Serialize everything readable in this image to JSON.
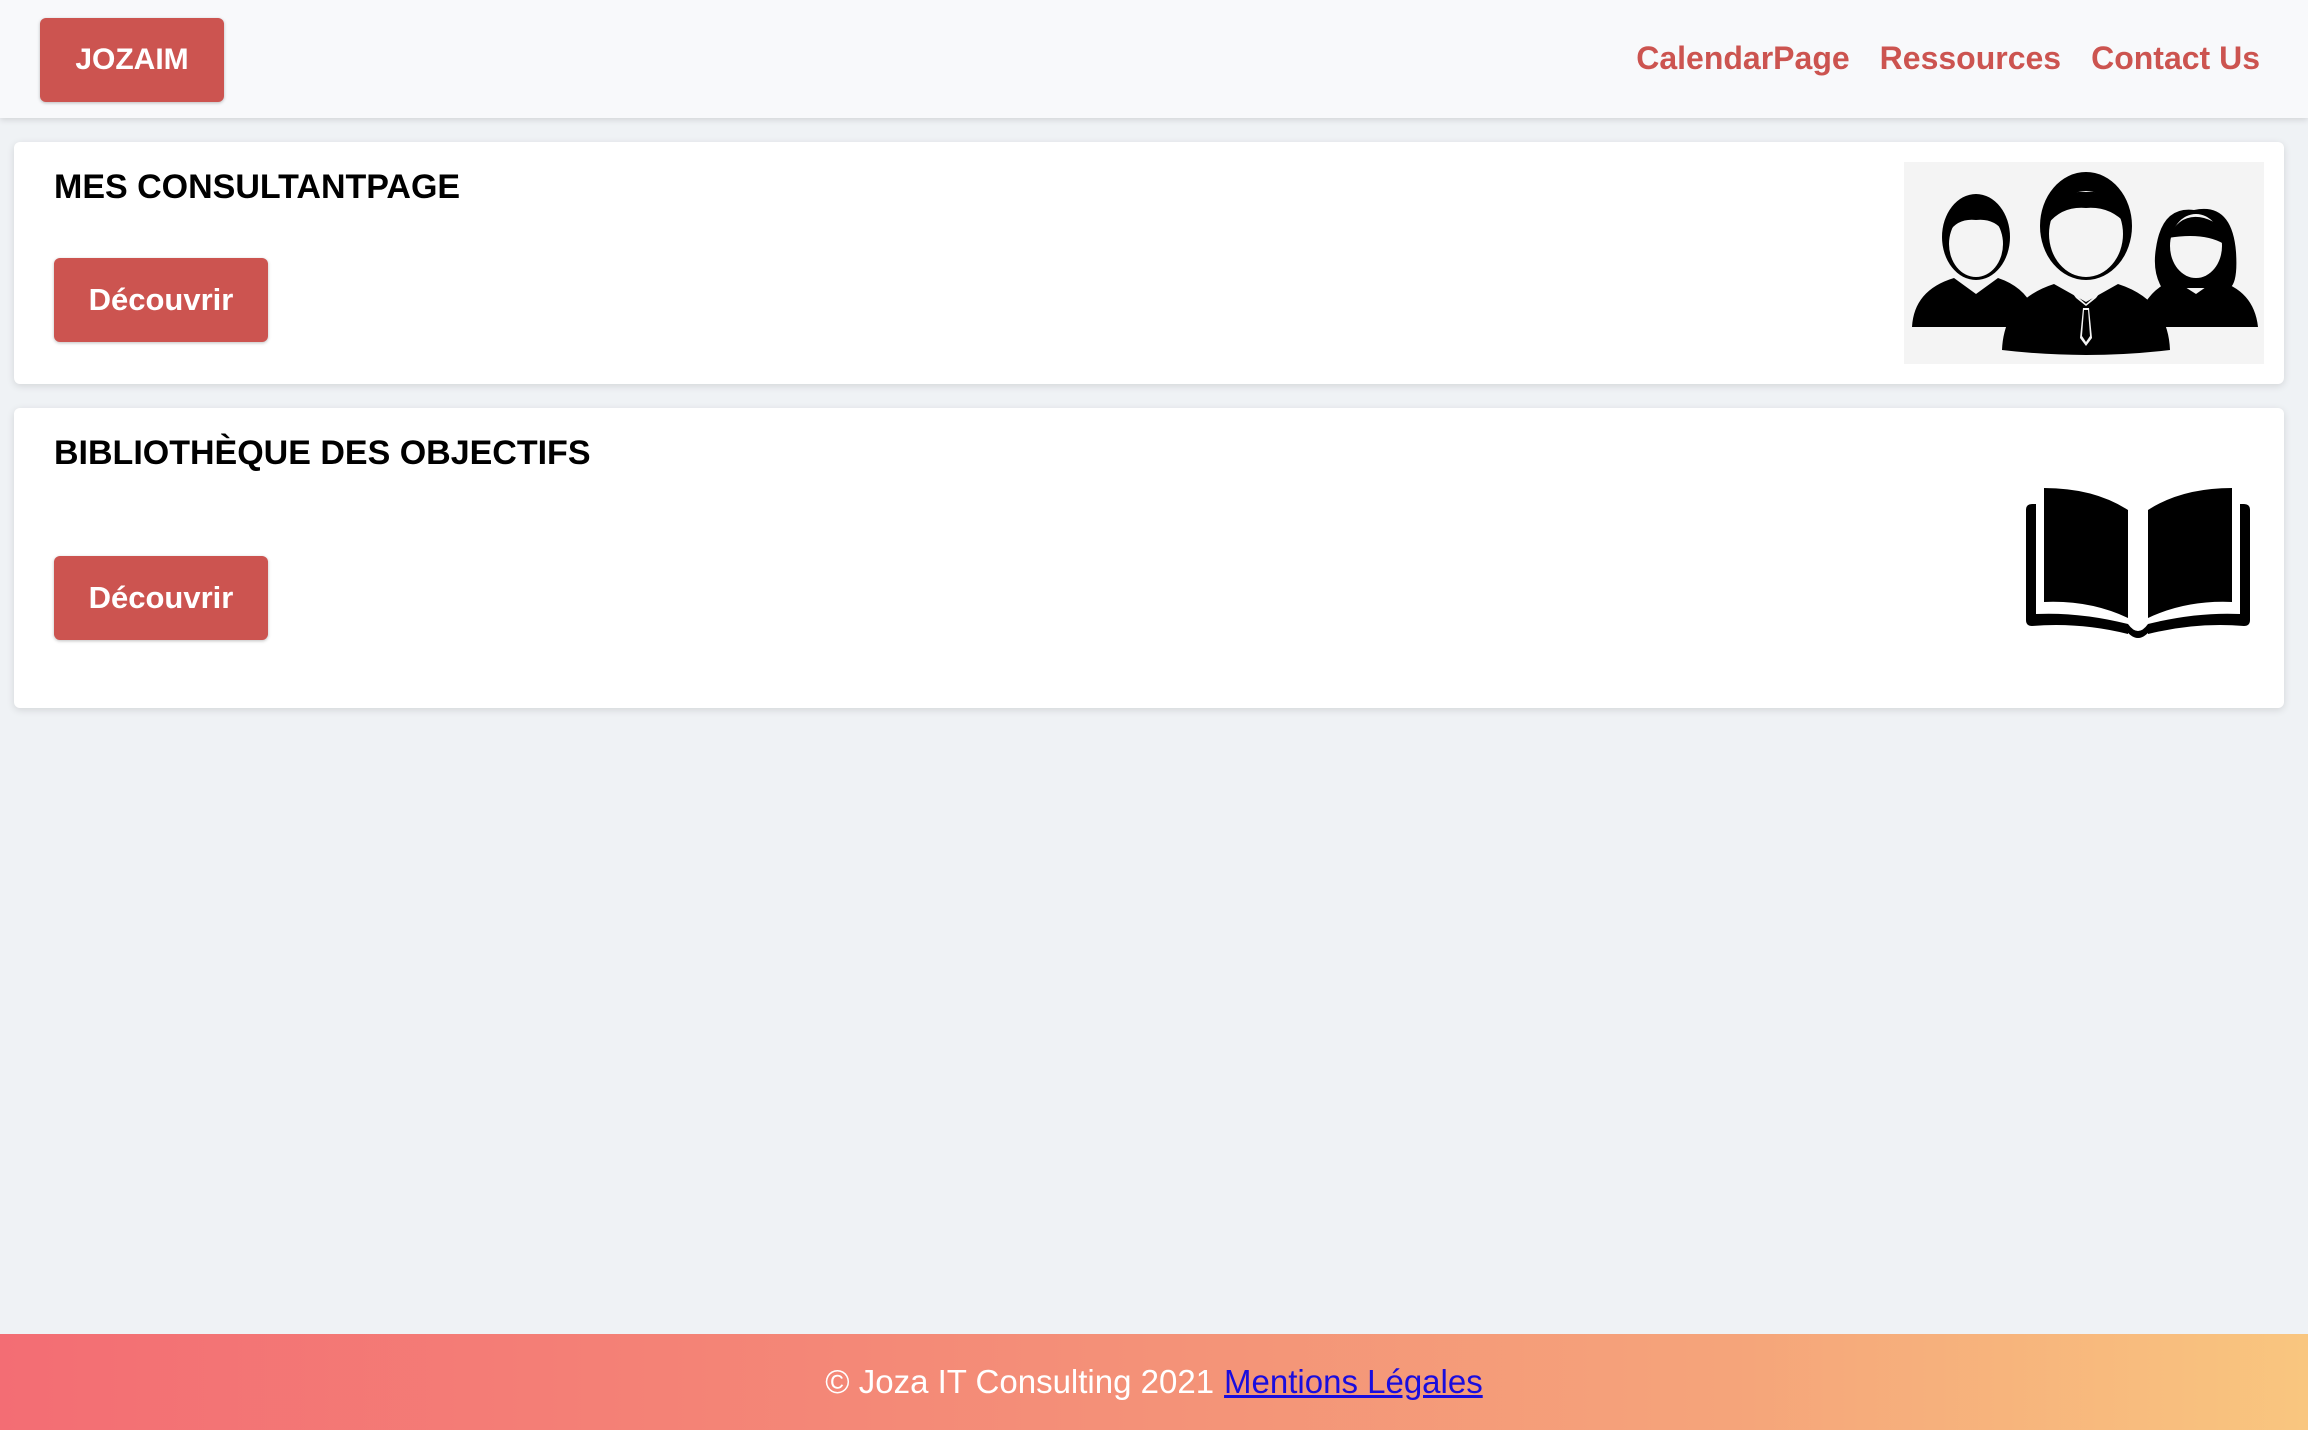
{
  "navbar": {
    "brand": "JOZAIM",
    "links": [
      "CalendarPage",
      "Ressources",
      "Contact Us"
    ]
  },
  "cards": [
    {
      "title": "MES CONSULTANTPAGE",
      "button": "Découvrir",
      "icon": "people-group-icon"
    },
    {
      "title": "BIBLIOTHÈQUE DES OBJECTIFS",
      "button": "Découvrir",
      "icon": "open-book-icon"
    }
  ],
  "footer": {
    "copyright": "© Joza IT Consulting 2021",
    "legal_link": "Mentions Légales"
  },
  "colors": {
    "accent": "#cc5450",
    "page_background": "#eff2f5",
    "footer_gradient_start": "#f36d74",
    "footer_gradient_end": "#f9c67f",
    "link": "#1a0dde"
  }
}
